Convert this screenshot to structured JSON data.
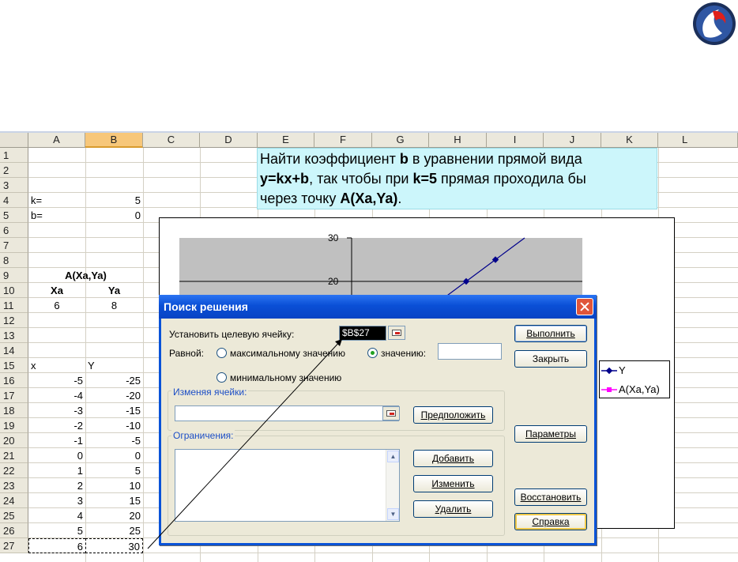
{
  "spreadsheet": {
    "columns": [
      "A",
      "B",
      "C",
      "D",
      "E",
      "F",
      "G",
      "H",
      "I",
      "J",
      "K",
      "L"
    ],
    "selected_column": "B",
    "rows": [
      "1",
      "2",
      "3",
      "4",
      "5",
      "6",
      "7",
      "8",
      "9",
      "10",
      "11",
      "12",
      "13",
      "14",
      "15",
      "16",
      "17",
      "18",
      "19",
      "20",
      "21",
      "22",
      "23",
      "24",
      "25",
      "26",
      "27"
    ],
    "k_label": "k=",
    "k_value": "5",
    "b_label": "b=",
    "b_value": "0",
    "point_title": "A(Xa,Ya)",
    "xa_header": "Xa",
    "ya_header": "Ya",
    "xa_value": "6",
    "ya_value": "8",
    "x_header": "x",
    "y_header": "Y",
    "table": [
      [
        "-5",
        "-25"
      ],
      [
        "-4",
        "-20"
      ],
      [
        "-3",
        "-15"
      ],
      [
        "-2",
        "-10"
      ],
      [
        "-1",
        "-5"
      ],
      [
        "0",
        "0"
      ],
      [
        "1",
        "5"
      ],
      [
        "2",
        "10"
      ],
      [
        "3",
        "15"
      ],
      [
        "4",
        "20"
      ],
      [
        "5",
        "25"
      ],
      [
        "6",
        "30"
      ]
    ]
  },
  "task": {
    "line1_a": "Найти  коэффициент ",
    "line1_b": "b",
    "line1_c": " в уравнении прямой вида",
    "line2_a": "y=kx+b",
    "line2_b": ", так чтобы при ",
    "line2_c": "k=5",
    "line2_d": " прямая проходила бы",
    "line3_a": "через точку ",
    "line3_b": "A(Xa,Ya)",
    "line3_c": "."
  },
  "chart_data": {
    "type": "line",
    "y_ticks": [
      "30",
      "20"
    ],
    "series": [
      {
        "name": "Y",
        "color": "#00008b",
        "x": [
          -5,
          -4,
          -3,
          -2,
          -1,
          0,
          1,
          2,
          3,
          4,
          5,
          6
        ],
        "values": [
          -25,
          -20,
          -15,
          -10,
          -5,
          0,
          5,
          10,
          15,
          20,
          25,
          30
        ]
      },
      {
        "name": "A(Xa,Ya)",
        "color": "#ff00ff",
        "x": [
          6
        ],
        "values": [
          8
        ]
      }
    ],
    "plot_background": "#c0c0c0",
    "legend_position": "right"
  },
  "dialog": {
    "title": "Поиск решения",
    "target_label": "Установить целевую ячейку:",
    "target_value": "$B$27",
    "equal_label": "Равной:",
    "radio_max": "максимальному значению",
    "radio_value": "значению:",
    "radio_min": "минимальному значению",
    "value_input": "",
    "changing_label": "Изменяя ячейки:",
    "changing_value": "",
    "constraints_label": "Ограничения:",
    "btn_execute": "Выполнить",
    "btn_close": "Закрыть",
    "btn_guess": "Предположить",
    "btn_params": "Параметры",
    "btn_add": "Добавить",
    "btn_change": "Изменить",
    "btn_delete": "Удалить",
    "btn_restore": "Восстановить",
    "btn_help": "Справка"
  }
}
